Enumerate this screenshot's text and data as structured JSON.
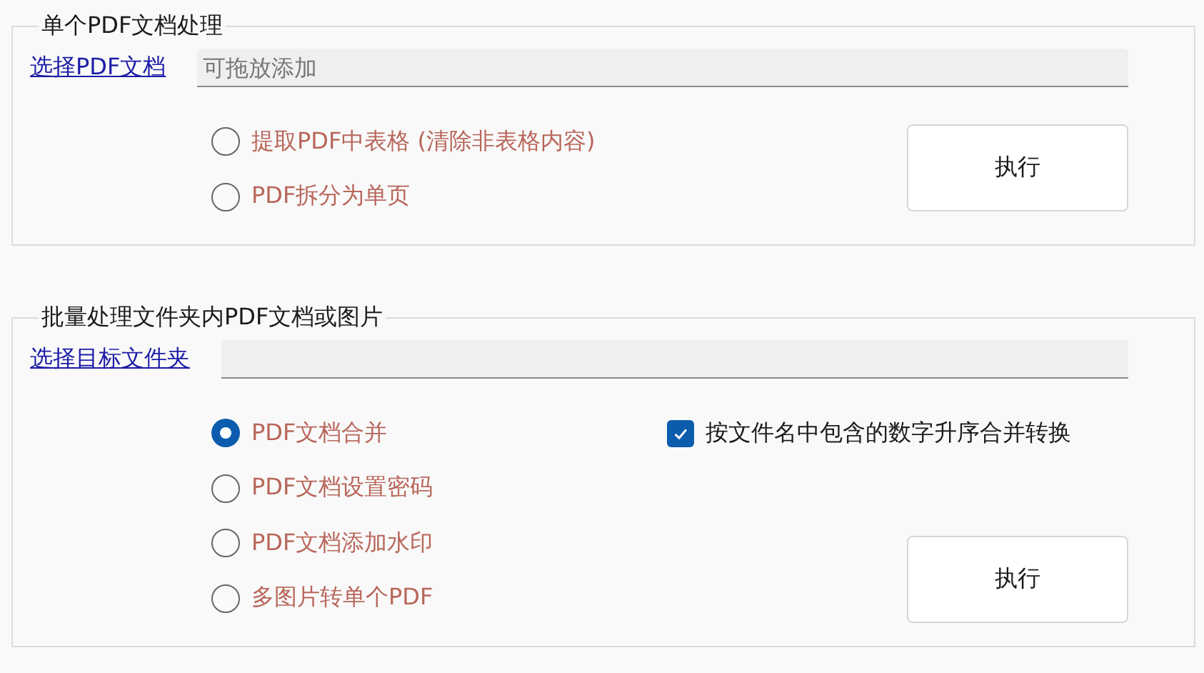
{
  "sections": [
    {
      "title": "单个PDF文档处理",
      "picker": {
        "label": "选择PDF文档",
        "placeholder": "可拖放添加"
      },
      "options": [
        {
          "label": "提取PDF中表格 (清除非表格内容)",
          "selected": false
        },
        {
          "label": "PDF拆分为单页",
          "selected": false
        }
      ],
      "button": "执行"
    },
    {
      "title": "批量处理文件夹内PDF文档或图片",
      "picker": {
        "label": "选择目标文件夹"
      },
      "options": [
        {
          "label": "PDF文档合并",
          "selected": true
        },
        {
          "label": "PDF文档设置密码",
          "selected": false
        },
        {
          "label": "PDF文档添加水印",
          "selected": false
        },
        {
          "label": "多图片转单个PDF",
          "selected": false
        }
      ],
      "checkbox": {
        "label": "按文件名中包含的数字升序合并转换",
        "checked": true
      },
      "button": "执行"
    }
  ]
}
